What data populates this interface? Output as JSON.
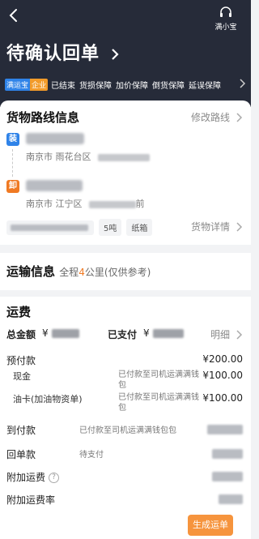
{
  "header": {
    "title": "待确认回单",
    "helper_label": "满小宝",
    "badge_a": "满运宝",
    "badge_b": "企业",
    "tags": [
      "已结束",
      "货损保障",
      "加价保障",
      "倒货保障",
      "延误保障"
    ]
  },
  "route": {
    "section_title": "货物路线信息",
    "edit_link": "修改路线",
    "load_pin": "装",
    "load_address": "南京市 雨花台区",
    "unload_pin": "卸",
    "unload_address": "南京市 江宁区",
    "unload_time_suffix": "前",
    "chips": [
      "5吨",
      "纸箱"
    ],
    "detail_link": "货物详情"
  },
  "transport": {
    "section_title": "运输信息",
    "distance_prefix": "全程",
    "distance_value": "4",
    "distance_suffix": "公里(仅供参考)"
  },
  "fee": {
    "section_title": "运费",
    "total_label": "总金额",
    "total_currency": "¥",
    "paid_label": "已支付",
    "paid_currency": "¥",
    "detail_link": "明细",
    "prepay_label": "预付款",
    "prepay_amount": "¥200.00",
    "cash_label": "现金",
    "cash_note": "已付款至司机运满满钱包",
    "cash_amount": "¥100.00",
    "fuel_label": "油卡(加油物资单)",
    "fuel_note": "已付款至司机运满满钱包",
    "fuel_amount": "¥100.00",
    "arrival_label": "到付款",
    "arrival_note": "已付款至司机运满满钱包包",
    "receipt_label": "回单款",
    "receipt_note": "待支付",
    "extra_label": "附加运费",
    "extra_rate_label": "附加运费率"
  },
  "actions": {
    "generate_label": "生成运单"
  }
}
